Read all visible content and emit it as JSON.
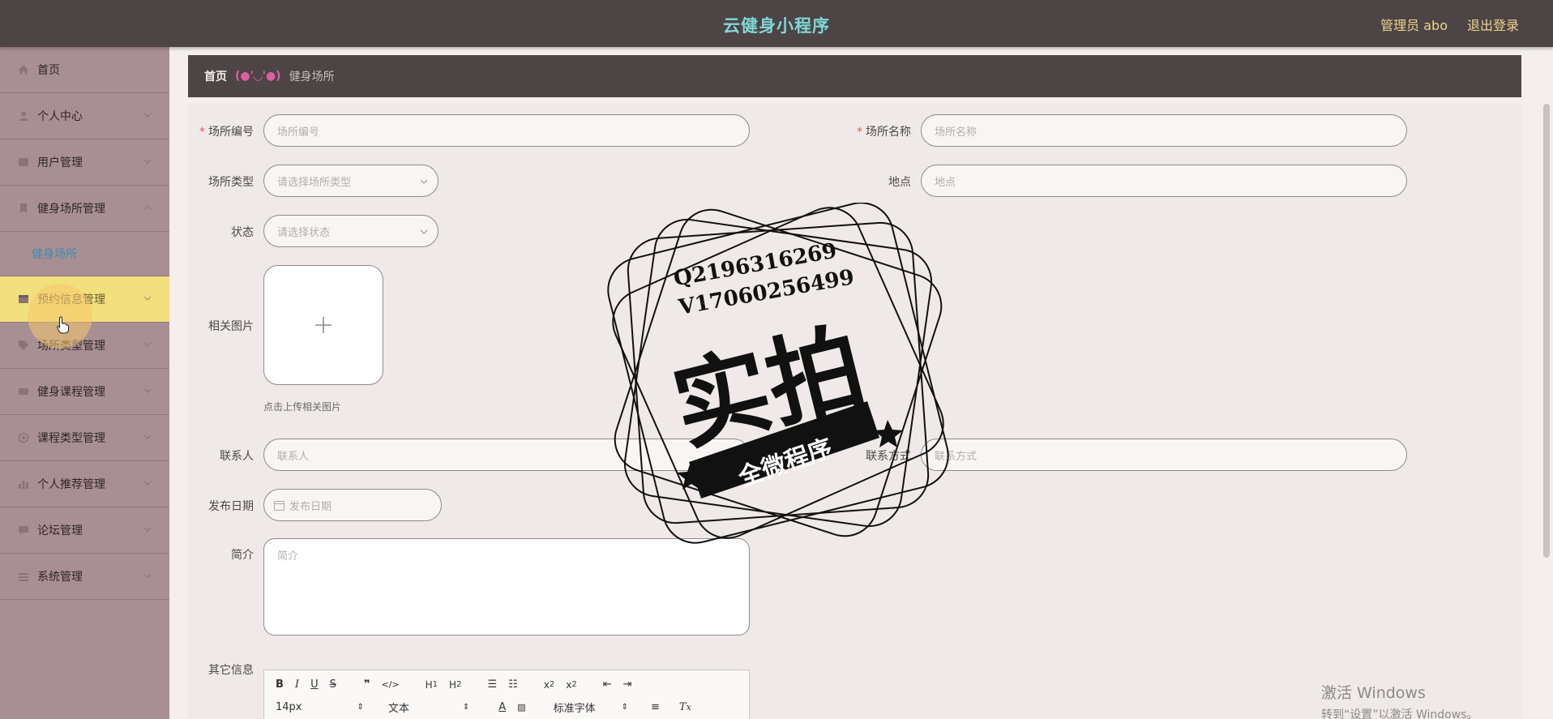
{
  "header": {
    "title": "云健身小程序",
    "admin": "管理员 abo",
    "logout": "退出登录"
  },
  "sidebar": {
    "items": [
      {
        "label": "首页",
        "icon": "home-icon"
      },
      {
        "label": "个人中心",
        "icon": "user-icon"
      },
      {
        "label": "用户管理",
        "icon": "users-icon"
      },
      {
        "label": "健身场所管理",
        "icon": "venue-icon"
      },
      {
        "label": "预约信息管理",
        "icon": "calendar-icon"
      },
      {
        "label": "场所类型管理",
        "icon": "tag-icon"
      },
      {
        "label": "健身课程管理",
        "icon": "course-icon"
      },
      {
        "label": "课程类型管理",
        "icon": "category-icon"
      },
      {
        "label": "个人推荐管理",
        "icon": "chart-icon"
      },
      {
        "label": "论坛管理",
        "icon": "forum-icon"
      },
      {
        "label": "系统管理",
        "icon": "settings-icon"
      }
    ],
    "submenu": {
      "label": "健身场所"
    },
    "active_item": "预约信息管理"
  },
  "breadcrumb": {
    "home": "首页",
    "separator": "(●'◡'●)",
    "current": "健身场所"
  },
  "form": {
    "venue_no": {
      "label": "场所编号",
      "placeholder": "场所编号",
      "required": true
    },
    "venue_name": {
      "label": "场所名称",
      "placeholder": "场所名称",
      "required": true
    },
    "venue_type": {
      "label": "场所类型",
      "placeholder": "请选择场所类型"
    },
    "location": {
      "label": "地点",
      "placeholder": "地点"
    },
    "status": {
      "label": "状态",
      "placeholder": "请选择状态"
    },
    "images": {
      "label": "相关图片",
      "hint": "点击上传相关图片"
    },
    "contact": {
      "label": "联系人",
      "placeholder": "联系人"
    },
    "contact_method": {
      "label": "联系方式",
      "placeholder": "联系方式"
    },
    "publish_date": {
      "label": "发布日期",
      "placeholder": "发布日期"
    },
    "intro": {
      "label": "简介",
      "placeholder": "简介"
    },
    "other_info": {
      "label": "其它信息"
    }
  },
  "editor": {
    "font_size": "14px",
    "text_style": "文本",
    "font_family": "标准字体"
  },
  "watermark": {
    "line1": "Q2196316269",
    "line2": "V17060256499",
    "big": "实拍",
    "banner": "全微程序"
  },
  "windows": {
    "title": "激活 Windows",
    "sub": "转到“设置”以激活 Windows。"
  }
}
